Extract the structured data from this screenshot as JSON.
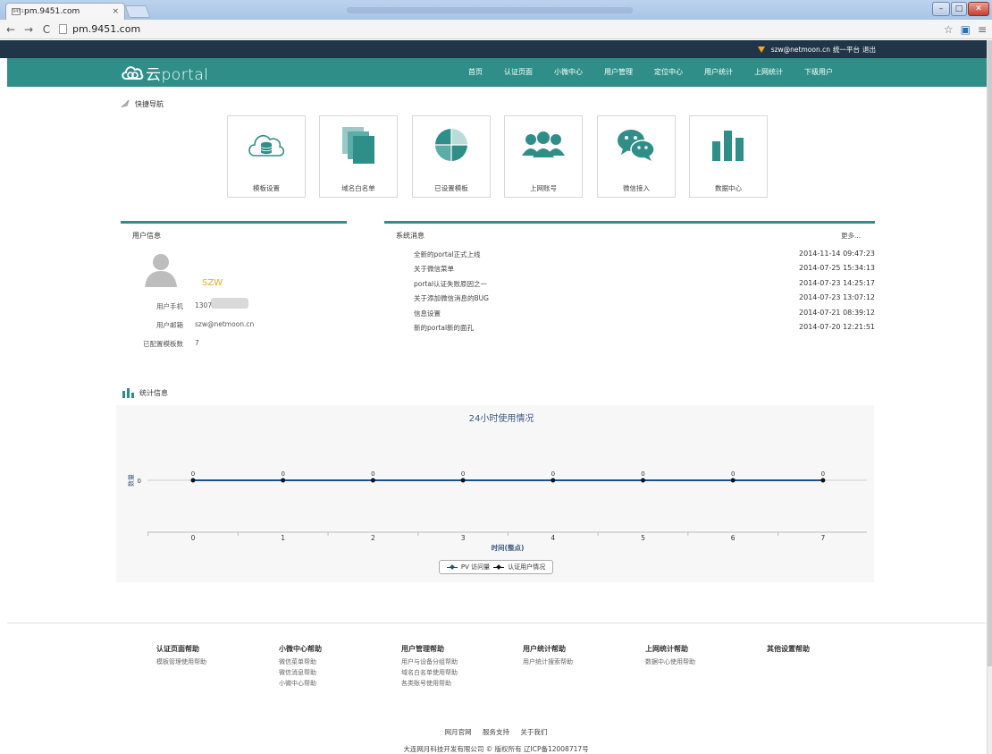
{
  "browser": {
    "tab_title": "pm.9451.com",
    "tab_close": "×",
    "favicon_text": "9451",
    "url": "pm.9451.com",
    "back": "←",
    "forward": "→",
    "reload": "C",
    "window_min": "–",
    "window_max": "□",
    "window_close": "✕"
  },
  "topbar": {
    "email": "szw@netmoon.cn",
    "platform": "统一平台",
    "logout": "退出"
  },
  "logo_text": "云portal",
  "nav": [
    "首页",
    "认证页面",
    "小微中心",
    "用户管理",
    "定位中心",
    "用户统计",
    "上网统计",
    "下级用户"
  ],
  "quicknav": {
    "title": "快捷导航",
    "tiles": [
      {
        "label": "模板设置",
        "icon": "cloud-database-icon"
      },
      {
        "label": "域名白名单",
        "icon": "stacked-pages-icon"
      },
      {
        "label": "已设置模板",
        "icon": "pie-chart-icon"
      },
      {
        "label": "上网账号",
        "icon": "users-icon"
      },
      {
        "label": "微信接入",
        "icon": "wechat-icon"
      },
      {
        "label": "数据中心",
        "icon": "bar-chart-icon"
      }
    ]
  },
  "user_info": {
    "title": "用户信息",
    "name": "SZW",
    "phone_label": "用户手机",
    "phone": "1307",
    "email_label": "用户邮箱",
    "email": "szw@netmoon.cn",
    "templates_label": "已配置模板数",
    "templates": "7"
  },
  "messages": {
    "title": "系统消息",
    "more": "更多...",
    "items": [
      {
        "text": "全新的portal正式上线",
        "date": "2014-11-14 09:47:23"
      },
      {
        "text": "关于微信菜单",
        "date": "2014-07-25 15:34:13"
      },
      {
        "text": "portal认证失败原因之一",
        "date": "2014-07-23 14:25:17"
      },
      {
        "text": "关于添加微信消息的BUG",
        "date": "2014-07-23 13:07:12"
      },
      {
        "text": "信息设置",
        "date": "2014-07-21 08:39:12"
      },
      {
        "text": "新的portal新的面孔",
        "date": "2014-07-20 12:21:51"
      }
    ]
  },
  "stats": {
    "title": "统计信息"
  },
  "chart_data": {
    "type": "line",
    "title": "24小时使用情况",
    "xlabel": "时间(整点)",
    "ylabel": "数量",
    "x": [
      0,
      1,
      2,
      3,
      4,
      5,
      6,
      7
    ],
    "yticks": [
      0
    ],
    "series": [
      {
        "name": "PV 访问量",
        "values": [
          0,
          0,
          0,
          0,
          0,
          0,
          0,
          0
        ],
        "color": "#1f4e8a"
      },
      {
        "name": "认证用户情况",
        "values": [
          0,
          0,
          0,
          0,
          0,
          0,
          0,
          0
        ],
        "color": "#111111"
      }
    ],
    "legend": "bottom-center"
  },
  "footer": {
    "columns": [
      {
        "title": "认证页面帮助",
        "items": [
          "模板管理使用帮助"
        ]
      },
      {
        "title": "小微中心帮助",
        "items": [
          "微信菜单帮助",
          "微信消息帮助",
          "小微中心帮助"
        ]
      },
      {
        "title": "用户管理帮助",
        "items": [
          "用户与设备分组帮助",
          "域名白名单使用帮助",
          "各类账号使用帮助"
        ]
      },
      {
        "title": "用户统计帮助",
        "items": [
          "用户统计搜索帮助"
        ]
      },
      {
        "title": "上网统计帮助",
        "items": [
          "数据中心使用帮助"
        ]
      },
      {
        "title": "其他设置帮助",
        "items": []
      }
    ],
    "links": [
      "网月官网",
      "服务支持",
      "关于我们"
    ],
    "copyright": "大连网月科技开发有限公司 © 版权所有 辽ICP备12008717号"
  }
}
